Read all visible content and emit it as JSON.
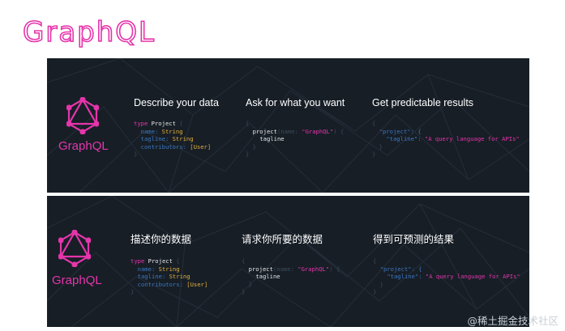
{
  "page_title": "GraphQL",
  "watermark": "@稀土掘金技术社区",
  "brand_color": "#e535ab",
  "banners": {
    "en": {
      "logo_text": "GraphQL",
      "col1_heading": "Describe your data",
      "col2_heading": "Ask for what you want",
      "col3_heading": "Get predictable results"
    },
    "zh": {
      "logo_text": "GraphQL",
      "col1_heading": "描述你的数据",
      "col2_heading": "请求你所要的数据",
      "col3_heading": "得到可预测的结果"
    }
  },
  "code": {
    "open_brace": "{",
    "close_brace": "}",
    "type_keyword": "type",
    "type_name": "Project",
    "field_name": "name:",
    "field_name_type": "String",
    "field_tagline": "tagline:",
    "field_tagline_type": "String",
    "field_contributors": "contributors:",
    "field_contributors_type": "[User]",
    "query_field": "project",
    "query_arg_open": "(name: ",
    "query_arg_value": "\"GraphQL\"",
    "query_arg_close": ") {",
    "query_sub": "tagline",
    "result_key_project": "\"project\": {",
    "result_key_tagline": "\"tagline\": ",
    "result_value": "\"A query language for APIs\""
  }
}
